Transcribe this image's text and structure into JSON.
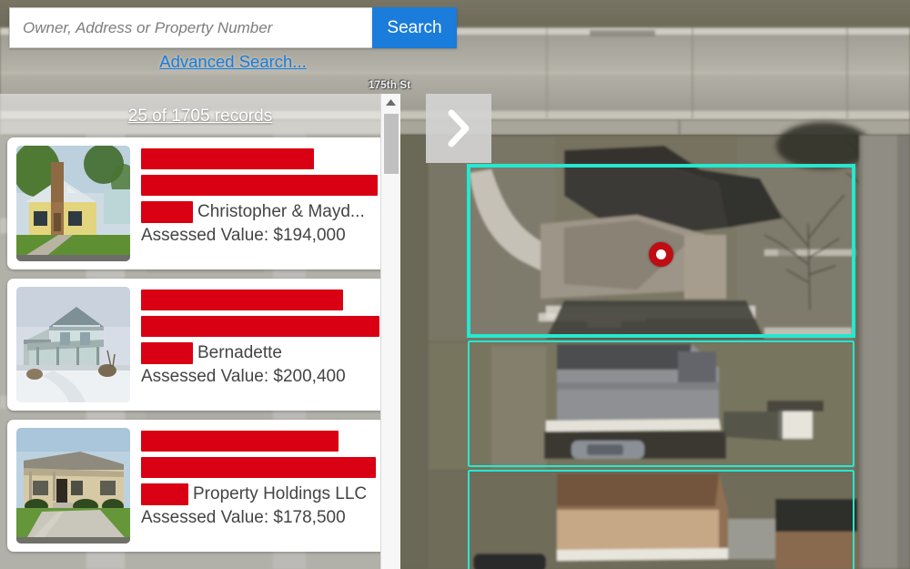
{
  "search": {
    "placeholder": "Owner, Address or Property Number",
    "value": "",
    "button_label": "Search",
    "advanced_label": "Advanced Search..."
  },
  "results": {
    "count_label": "25 of 1705 records",
    "shown": 25,
    "total": 1705,
    "cards": [
      {
        "owner_name": "Christopher & Mayd...",
        "assessed_label": "Assessed Value: $194,000",
        "assessed_value": "$194,000",
        "redactions": [
          190,
          260,
          57
        ],
        "thumb": "house-tan-bungalow-summer"
      },
      {
        "owner_name": "Bernadette",
        "assessed_label": "Assessed Value: $200,400",
        "assessed_value": "$200,400",
        "redactions": [
          222,
          262,
          57
        ],
        "thumb": "house-blue-twostory-winter"
      },
      {
        "owner_name": "Property Holdings LLC",
        "assessed_label": "Assessed Value: $178,500",
        "assessed_value": "$178,500",
        "redactions": [
          217,
          258,
          52
        ],
        "thumb": "house-tan-ranch-summer"
      }
    ]
  },
  "map": {
    "street_label": "175th St",
    "next_button_icon": "chevron-right-icon",
    "marker_icon": "location-marker-icon",
    "parcel_highlight_color": "#24e8d0",
    "marker_color": "#c00d13"
  },
  "colors": {
    "accent_blue": "#1a7cdb",
    "redaction_red": "#d80012",
    "parcel_cyan": "#24e8d0"
  }
}
